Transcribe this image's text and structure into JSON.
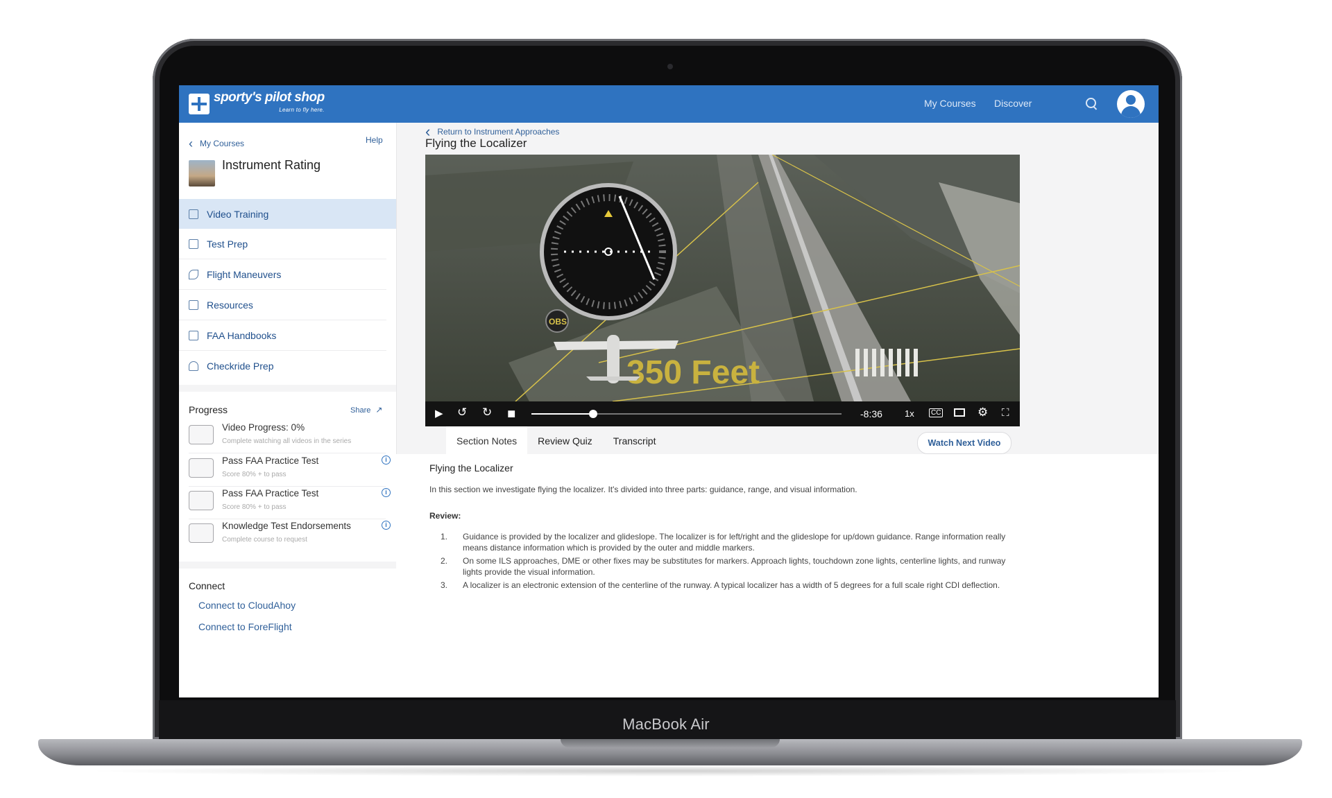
{
  "device": {
    "model": "MacBook Air"
  },
  "header": {
    "brand": "sporty's pilot shop",
    "tagline": "Learn to fly here.",
    "nav": [
      "My Courses",
      "Discover"
    ]
  },
  "sidebar": {
    "back_label": "My Courses",
    "help_label": "Help",
    "course_title": "Instrument Rating",
    "items": [
      {
        "label": "Video Training",
        "active": true
      },
      {
        "label": "Test Prep"
      },
      {
        "label": "Flight Maneuvers"
      },
      {
        "label": "Resources"
      },
      {
        "label": "FAA Handbooks"
      },
      {
        "label": "Checkride Prep"
      }
    ],
    "progress": {
      "heading": "Progress",
      "share_label": "Share",
      "items": [
        {
          "title": "Video Progress: 0%",
          "subtitle": "Complete watching all videos in the series",
          "value": 0
        },
        {
          "title": "Pass FAA Practice Test",
          "subtitle": "Score 80% + to pass"
        },
        {
          "title": "Pass FAA Practice Test",
          "subtitle": "Score 80% + to pass"
        },
        {
          "title": "Knowledge Test Endorsements",
          "subtitle": "Complete course to request"
        }
      ]
    },
    "connect": {
      "heading": "Connect",
      "links": [
        "Connect to CloudAhoy",
        "Connect to ForeFlight"
      ]
    }
  },
  "main": {
    "back_label": "Return to Instrument Approaches",
    "title": "Flying the Localizer",
    "video": {
      "overlay_text": "350 Feet",
      "obs_label": "OBS",
      "time_remaining": "-8:36",
      "speed": "1x",
      "cc_label": "CC",
      "progress": 0.2
    },
    "tabs": [
      "Section Notes",
      "Review Quiz",
      "Transcript"
    ],
    "watch_next_label": "Watch Next Video",
    "notes": {
      "heading": "Flying the Localizer",
      "intro": "In this section we investigate flying the localizer. It's divided into three parts: guidance, range, and visual information.",
      "review_label": "Review:",
      "items": [
        "Guidance is provided by the localizer and glideslope. The localizer is for left/right and the glideslope for up/down guidance. Range information really means distance information which is provided by the outer and middle markers.",
        "On some ILS approaches, DME or other fixes may be substitutes for markers. Approach lights, touchdown zone lights, centerline lights, and runway lights provide the visual information.",
        "A localizer is an electronic extension of the centerline of the runway. A typical localizer has a width of 5 degrees for a full scale right CDI deflection."
      ]
    }
  }
}
